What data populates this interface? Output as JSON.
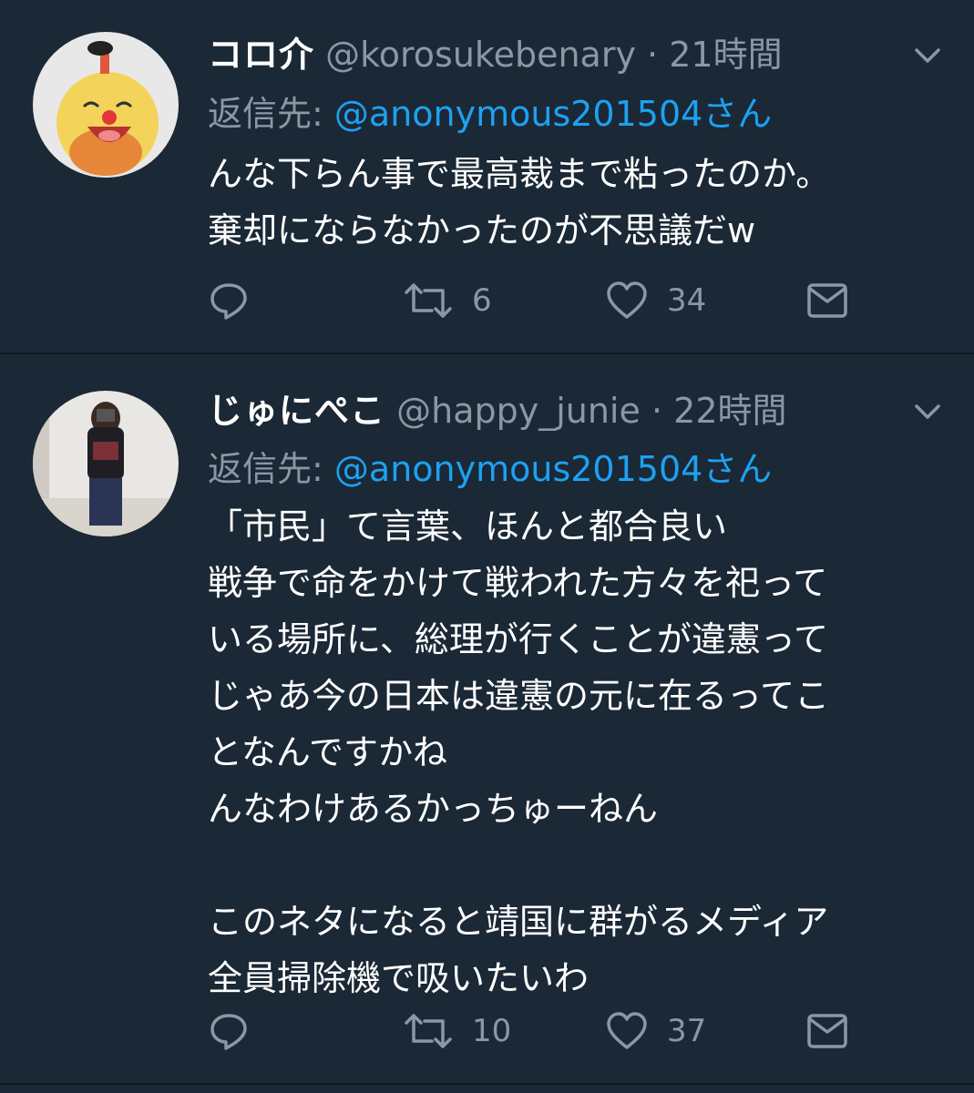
{
  "tweets": [
    {
      "author_name": "コロ介",
      "handle": "@korosukebenary",
      "separator": "·",
      "time": "21時間",
      "reply_label": "返信先:",
      "reply_to": "@anonymous201504さん",
      "text": "んな下らん事で最高裁まで粘ったのか。\n棄却にならなかったのが不思議だw",
      "retweets": "6",
      "likes": "34"
    },
    {
      "author_name": "じゅにぺこ",
      "handle": "@happy_junie",
      "separator": "·",
      "time": "22時間",
      "reply_label": "返信先:",
      "reply_to": "@anonymous201504さん",
      "text": "「市民」て言葉、ほんと都合良い\n戦争で命をかけて戦われた方々を祀って\nいる場所に、総理が行くことが違憲って\nじゃあ今の日本は違憲の元に在るってこ\nとなんですかね\nんなわけあるかっちゅーねん\n\nこのネタになると靖国に群がるメディア\n全員掃除機で吸いたいわ",
      "retweets": "10",
      "likes": "37"
    }
  ],
  "icons": {
    "reply": "reply-icon",
    "retweet": "retweet-icon",
    "like": "heart-icon",
    "dm": "envelope-icon",
    "caret": "chevron-down-icon"
  },
  "colors": {
    "background": "#1b2835",
    "divider": "#0f1720",
    "muted": "#8899a6",
    "link": "#1da1f2",
    "text": "#ffffff"
  }
}
